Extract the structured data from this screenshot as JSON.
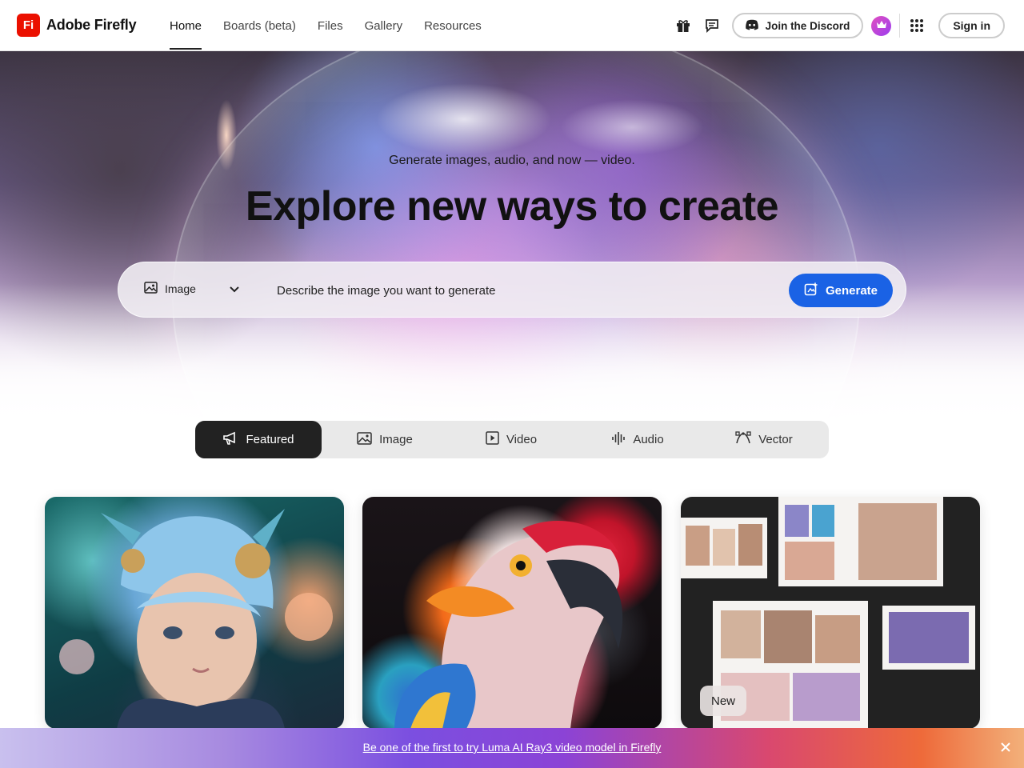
{
  "brand": {
    "logo_text": "Fi",
    "name": "Adobe Firefly",
    "logo_color": "#eb1000"
  },
  "nav": {
    "items": [
      {
        "label": "Home",
        "active": true
      },
      {
        "label": "Boards (beta)",
        "active": false
      },
      {
        "label": "Files",
        "active": false
      },
      {
        "label": "Gallery",
        "active": false
      },
      {
        "label": "Resources",
        "active": false
      }
    ]
  },
  "header_actions": {
    "discord_label": "Join the Discord",
    "signin_label": "Sign in",
    "icons": [
      "gift-icon",
      "chat-icon",
      "discord-icon",
      "crown-icon",
      "apps-grid-icon"
    ]
  },
  "hero": {
    "subtitle": "Generate images, audio, and now — video.",
    "title": "Explore new ways to create"
  },
  "prompt": {
    "type_label": "Image",
    "placeholder": "Describe the image you want to generate",
    "generate_label": "Generate",
    "accent": "#1a62e5"
  },
  "tabs": [
    {
      "label": "Featured",
      "icon": "megaphone-icon",
      "active": true
    },
    {
      "label": "Image",
      "icon": "image-icon",
      "active": false
    },
    {
      "label": "Video",
      "icon": "video-icon",
      "active": false
    },
    {
      "label": "Audio",
      "icon": "audio-wave-icon",
      "active": false
    },
    {
      "label": "Vector",
      "icon": "vector-pen-icon",
      "active": false
    }
  ],
  "cards": {
    "badge": "New"
  },
  "promo": {
    "link_text": "Be one of the first to try Luma AI Ray3 video model in Firefly"
  }
}
